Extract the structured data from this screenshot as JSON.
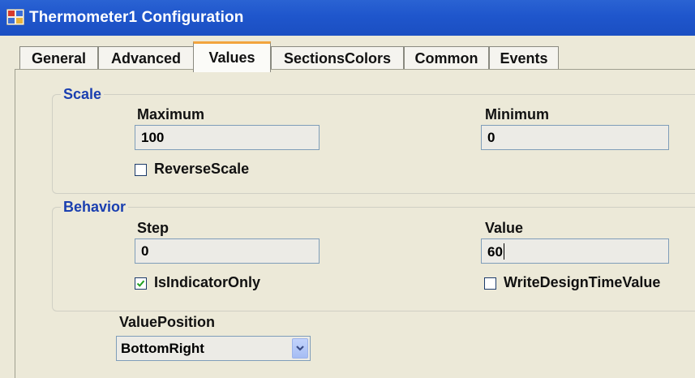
{
  "window": {
    "title": "Thermometer1 Configuration"
  },
  "tabs": [
    {
      "label": "General"
    },
    {
      "label": "Advanced"
    },
    {
      "label": "Values"
    },
    {
      "label": "SectionsColors"
    },
    {
      "label": "Common"
    },
    {
      "label": "Events"
    }
  ],
  "active_tab": "Values",
  "scale": {
    "legend": "Scale",
    "maximum_label": "Maximum",
    "maximum_value": "100",
    "minimum_label": "Minimum",
    "minimum_value": "0",
    "reverse_scale_label": "ReverseScale",
    "reverse_scale_checked": false
  },
  "behavior": {
    "legend": "Behavior",
    "step_label": "Step",
    "step_value": "0",
    "value_label": "Value",
    "value_value": "60",
    "is_indicator_only_label": "IsIndicatorOnly",
    "is_indicator_only_checked": true,
    "write_design_time_value_label": "WriteDesignTimeValue",
    "write_design_time_value_checked": false
  },
  "value_position": {
    "label": "ValuePosition",
    "selected": "BottomRight"
  },
  "colors": {
    "titlebar": "#1f56cc",
    "legend_text": "#1a3fb0",
    "active_tab_accent": "#f2a43e",
    "check_mark": "#21a121"
  }
}
